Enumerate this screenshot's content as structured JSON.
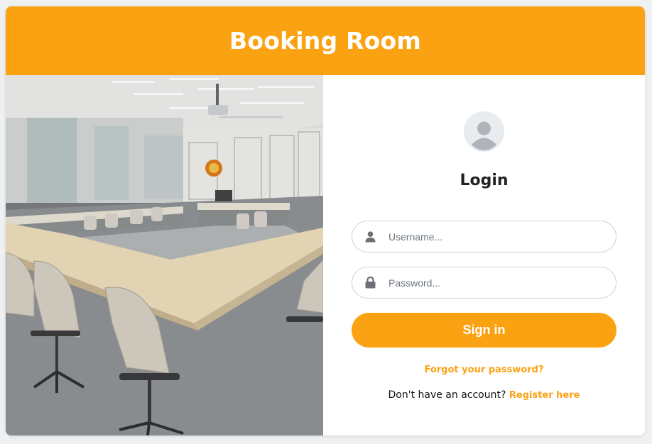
{
  "header": {
    "title": "Booking Room"
  },
  "login": {
    "title": "Login",
    "username": {
      "placeholder": "Username...",
      "value": ""
    },
    "password": {
      "placeholder": "Password...",
      "value": ""
    },
    "signin_label": "Sign in",
    "forgot_label": "Forgot your password?",
    "register_prompt": "Don't have an account?",
    "register_link": "Register here"
  },
  "icons": {
    "avatar": "user-circle-icon",
    "username": "user-icon",
    "password": "lock-icon"
  },
  "colors": {
    "accent": "#fba213",
    "header_text": "#ffffff",
    "avatar_bg": "#e9ecef",
    "icon": "#7a7f85"
  }
}
